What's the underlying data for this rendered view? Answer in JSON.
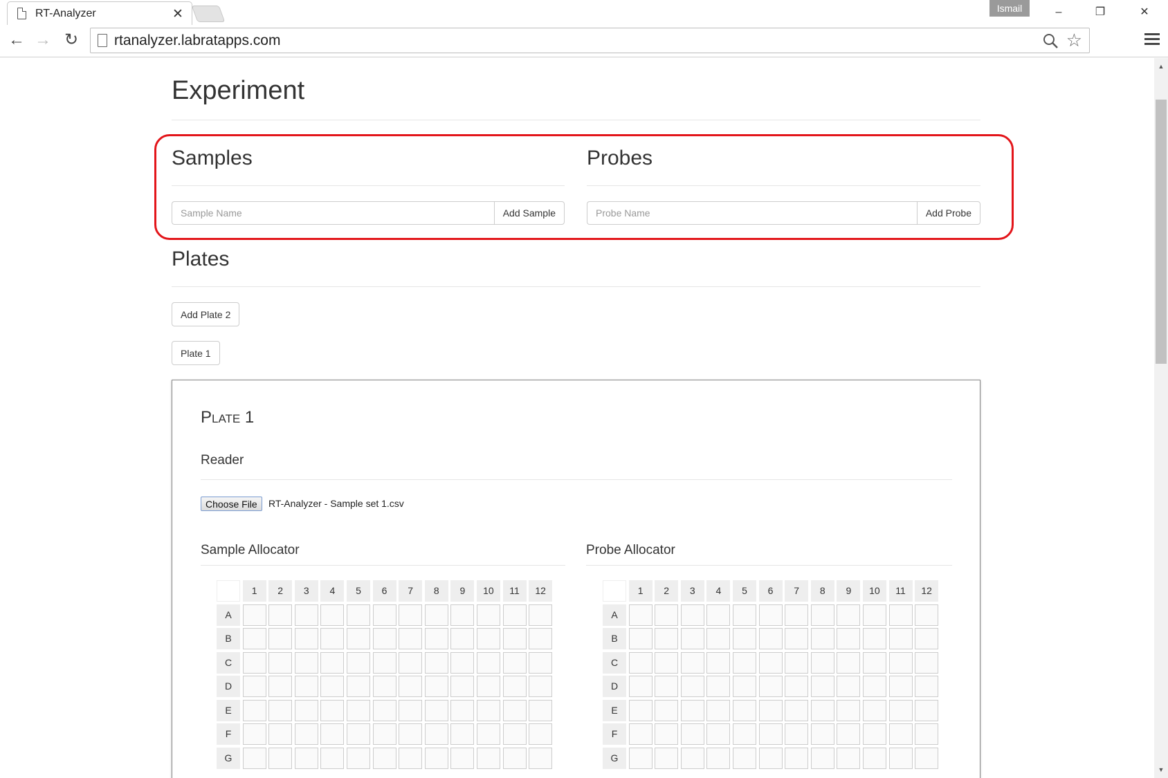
{
  "browser": {
    "tab_title": "RT-Analyzer",
    "tab_close": "✕",
    "user_badge": "Ismail",
    "window_controls": [
      "–",
      "❐",
      "✕"
    ],
    "url": "rtanalyzer.labratapps.com",
    "nav": {
      "back": "←",
      "forward": "→",
      "reload": "↻"
    }
  },
  "page": {
    "title": "Experiment",
    "samples": {
      "heading": "Samples",
      "placeholder": "Sample Name",
      "button": "Add Sample"
    },
    "probes": {
      "heading": "Probes",
      "placeholder": "Probe Name",
      "button": "Add Probe"
    },
    "plates": {
      "heading": "Plates",
      "add_button": "Add Plate 2",
      "plate_buttons": [
        "Plate 1"
      ]
    },
    "plate_panel": {
      "title": "Plate 1",
      "reader_heading": "Reader",
      "file_button": "Choose File",
      "file_name": "RT-Analyzer - Sample set 1.csv",
      "sample_allocator": "Sample Allocator",
      "probe_allocator": "Probe Allocator",
      "columns": [
        "1",
        "2",
        "3",
        "4",
        "5",
        "6",
        "7",
        "8",
        "9",
        "10",
        "11",
        "12"
      ],
      "rows": [
        "A",
        "B",
        "C",
        "D",
        "E",
        "F",
        "G"
      ]
    }
  },
  "colors": {
    "annotation": "#e3151a",
    "cell_border": "#cccccc",
    "header_bg": "#eeeeee"
  }
}
